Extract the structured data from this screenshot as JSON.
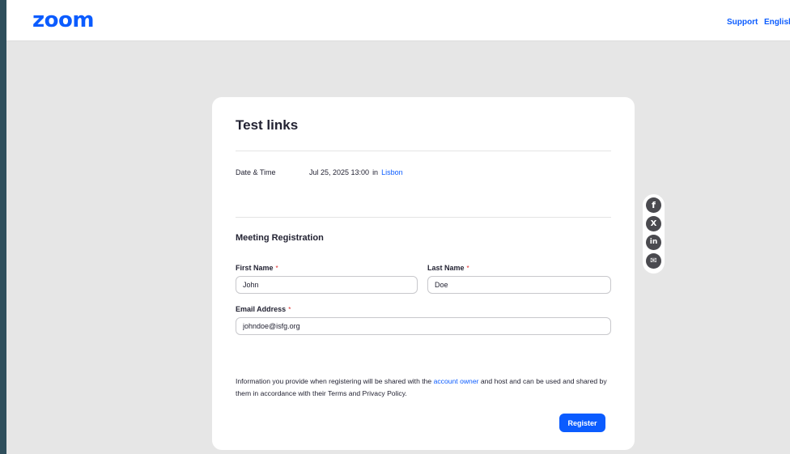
{
  "header": {
    "logo": "zoom",
    "support_label": "Support",
    "language_label": "English"
  },
  "meeting": {
    "title": "Test links",
    "date_time_label": "Date & Time",
    "date_time_value": "Jul 25, 2025 13:00",
    "in_label": "in",
    "timezone_city": "Lisbon"
  },
  "registration": {
    "section_title": "Meeting Registration",
    "required_marker": "*",
    "first_name": {
      "label": "First Name",
      "value": "John"
    },
    "last_name": {
      "label": "Last Name",
      "value": "Doe"
    },
    "email": {
      "label": "Email Address",
      "value": "johndoe@isfg.org"
    },
    "info_before": "Information you provide when registering will be shared with the ",
    "info_link": "account owner",
    "info_after": " and host and can be used and shared by them in accordance with their Terms and Privacy Policy.",
    "register_label": "Register"
  },
  "share": {
    "icons": [
      "facebook-icon",
      "x-icon",
      "linkedin-icon",
      "mail-icon"
    ],
    "glyphs": {
      "facebook": "f",
      "x": "X",
      "linkedin": "in",
      "mail": "✉"
    }
  },
  "colors": {
    "brand": "#0b5cff",
    "background": "#e6e6e6",
    "required": "#e02828"
  }
}
